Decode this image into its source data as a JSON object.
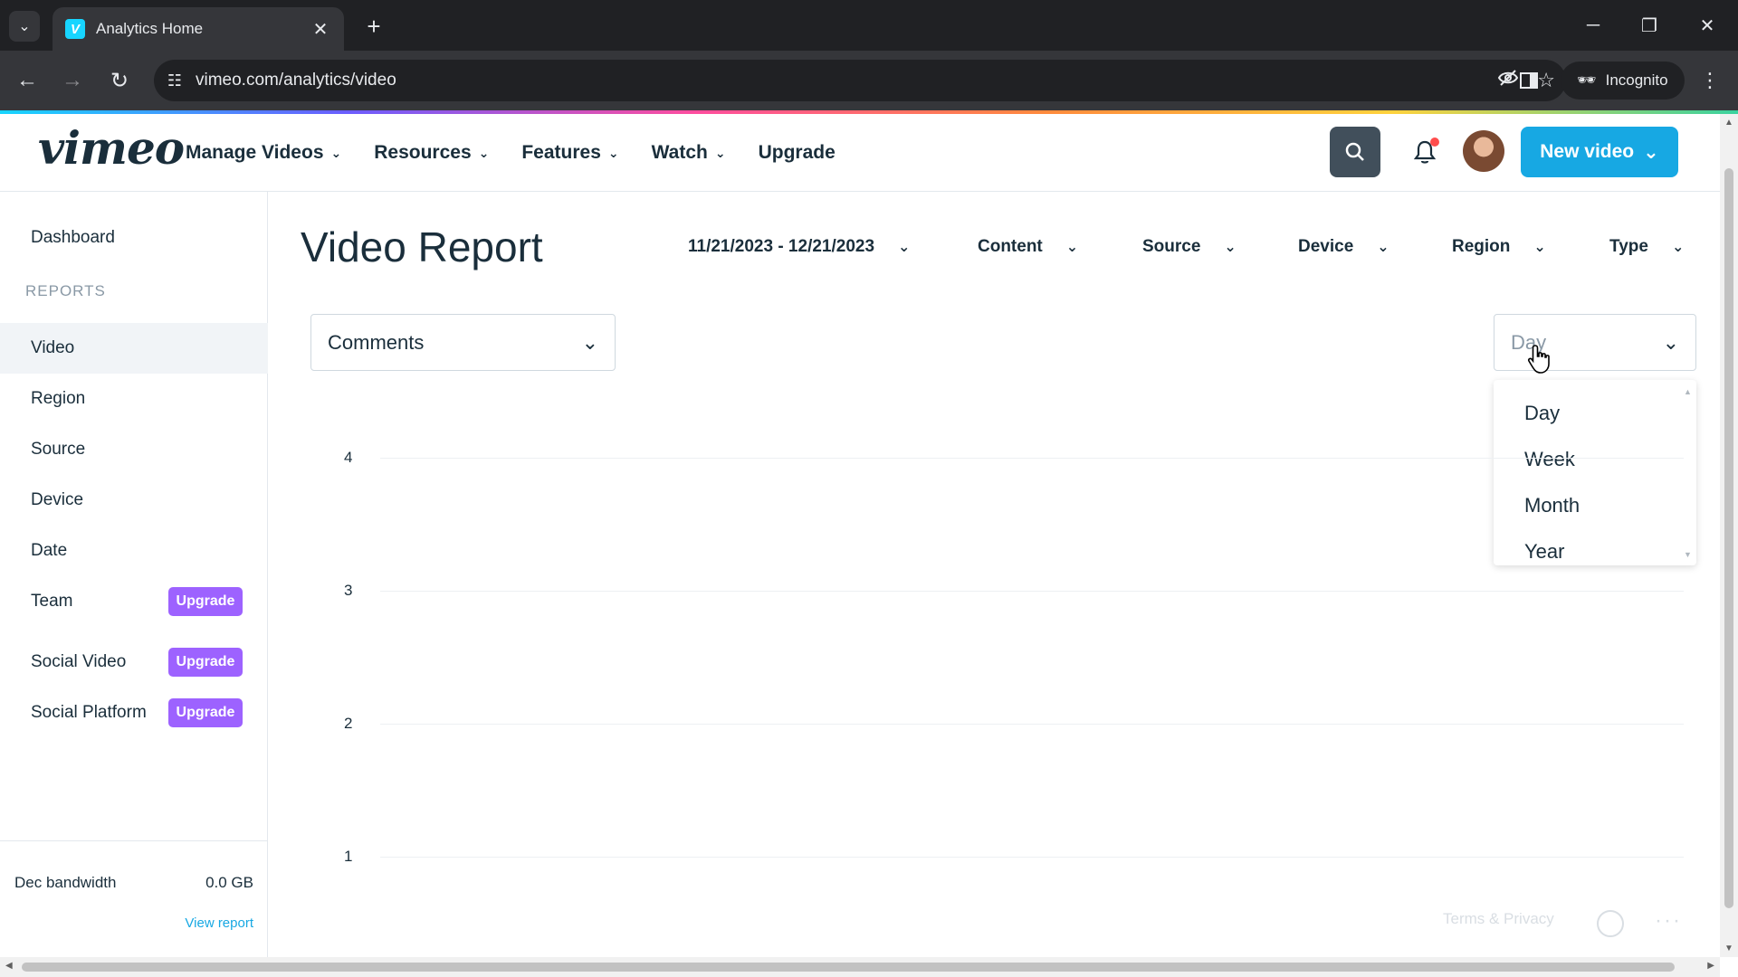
{
  "browser": {
    "tab_title": "Analytics Home",
    "url": "vimeo.com/analytics/video",
    "incognito_label": "Incognito"
  },
  "header": {
    "logo": "vimeo",
    "nav": [
      {
        "label": "Manage Videos"
      },
      {
        "label": "Resources"
      },
      {
        "label": "Features"
      },
      {
        "label": "Watch"
      },
      {
        "label": "Upgrade"
      }
    ],
    "new_video_label": "New video"
  },
  "sidebar": {
    "dashboard": "Dashboard",
    "reports_heading": "REPORTS",
    "items": [
      {
        "label": "Video",
        "active": true
      },
      {
        "label": "Region"
      },
      {
        "label": "Source"
      },
      {
        "label": "Device"
      },
      {
        "label": "Date"
      },
      {
        "label": "Team",
        "badge": "Upgrade"
      },
      {
        "label": "Social Video",
        "badge": "Upgrade"
      },
      {
        "label": "Social Platform",
        "badge": "Upgrade"
      }
    ],
    "bandwidth_label": "Dec bandwidth",
    "bandwidth_value": "0.0 GB",
    "view_report": "View report"
  },
  "main": {
    "title": "Video Report",
    "filters": {
      "date_range": "11/21/2023 - 12/21/2023",
      "content": "Content",
      "source": "Source",
      "device": "Device",
      "region": "Region",
      "type": "Type"
    },
    "metric_select": "Comments",
    "period_select": "Day",
    "period_options": [
      "Day",
      "Week",
      "Month",
      "Year"
    ],
    "footer_link": "Terms & Privacy"
  },
  "chart_data": {
    "type": "line",
    "y_ticks": [
      "4",
      "3",
      "2",
      "1"
    ],
    "ylim": [
      1,
      4
    ],
    "grid": true,
    "series": []
  },
  "colors": {
    "accent": "#17a8e3",
    "upgrade_badge": "#9d62ff",
    "text": "#1a2e3b"
  }
}
